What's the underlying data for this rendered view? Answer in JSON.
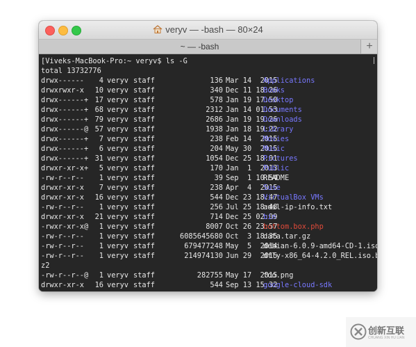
{
  "window": {
    "title": "veryv — -bash — 80×24",
    "tab_label": "~ — -bash",
    "new_tab_symbol": "+",
    "home_icon": "home-icon"
  },
  "terminal": {
    "prompt_line": "[Viveks-MacBook-Pro:~ veryv$ ls -G",
    "total_line": "total 13732776",
    "entries": [
      {
        "perm": "drwx------",
        "links": "4",
        "owner": "veryv",
        "group": "staff",
        "size": "136",
        "date": "Mar 14  2015",
        "name": "Applications",
        "kind": "dir"
      },
      {
        "perm": "drwxrwxr-x",
        "links": "10",
        "owner": "veryv",
        "group": "staff",
        "size": "340",
        "date": "Dec 11 18:26",
        "name": "Books",
        "kind": "dir"
      },
      {
        "perm": "drwx------+",
        "links": "17",
        "owner": "veryv",
        "group": "staff",
        "size": "578",
        "date": "Jan 19 17:50",
        "name": "Desktop",
        "kind": "dir"
      },
      {
        "perm": "drwx------+",
        "links": "68",
        "owner": "veryv",
        "group": "staff",
        "size": "2312",
        "date": "Jan 14 01:53",
        "name": "Documents",
        "kind": "dir"
      },
      {
        "perm": "drwx------+",
        "links": "79",
        "owner": "veryv",
        "group": "staff",
        "size": "2686",
        "date": "Jan 19 19:26",
        "name": "Downloads",
        "kind": "dir"
      },
      {
        "perm": "drwx------@",
        "links": "57",
        "owner": "veryv",
        "group": "staff",
        "size": "1938",
        "date": "Jan 18 19:22",
        "name": "Library",
        "kind": "dir"
      },
      {
        "perm": "drwx------+",
        "links": "7",
        "owner": "veryv",
        "group": "staff",
        "size": "238",
        "date": "Feb 14  2015",
        "name": "Movies",
        "kind": "dir"
      },
      {
        "perm": "drwx------+",
        "links": "6",
        "owner": "veryv",
        "group": "staff",
        "size": "204",
        "date": "May 30  2015",
        "name": "Music",
        "kind": "dir"
      },
      {
        "perm": "drwx------+",
        "links": "31",
        "owner": "veryv",
        "group": "staff",
        "size": "1054",
        "date": "Dec 25 18:01",
        "name": "Pictures",
        "kind": "dir"
      },
      {
        "perm": "drwxr-xr-x+",
        "links": "5",
        "owner": "veryv",
        "group": "staff",
        "size": "170",
        "date": "Jan  1  2013",
        "name": "Public",
        "kind": "dir"
      },
      {
        "perm": "-rw-r--r--",
        "links": "1",
        "owner": "veryv",
        "group": "staff",
        "size": "39",
        "date": "Sep  1 10:54",
        "name": "README",
        "kind": "file"
      },
      {
        "perm": "drwxr-xr-x",
        "links": "7",
        "owner": "veryv",
        "group": "staff",
        "size": "238",
        "date": "Apr  4  2015",
        "name": "Suse",
        "kind": "dir"
      },
      {
        "perm": "drwxr-xr-x",
        "links": "16",
        "owner": "veryv",
        "group": "staff",
        "size": "544",
        "date": "Dec 23 18:47",
        "name": "VirtualBox VMs",
        "kind": "dir"
      },
      {
        "perm": "-rw-r--r--",
        "links": "1",
        "owner": "veryv",
        "group": "staff",
        "size": "256",
        "date": "Jul 25 18:48",
        "name": "adsl-ip-info.txt",
        "kind": "file"
      },
      {
        "perm": "drwxr-xr-x",
        "links": "21",
        "owner": "veryv",
        "group": "staff",
        "size": "714",
        "date": "Dec 25 02:09",
        "name": "bin",
        "kind": "dir"
      },
      {
        "perm": "-rwxr-xr-x@",
        "links": "1",
        "owner": "veryv",
        "group": "staff",
        "size": "8007",
        "date": "Oct 26 23:57",
        "name": "bottom.box.php",
        "kind": "exe"
      },
      {
        "perm": "-rw-r--r--",
        "links": "1",
        "owner": "veryv",
        "group": "staff",
        "size": "6085645680",
        "date": "Oct  3 18:35",
        "name": "data.tar.gz",
        "kind": "file"
      },
      {
        "perm": "-rw-r--r--",
        "links": "1",
        "owner": "veryv",
        "group": "staff",
        "size": "679477248",
        "date": "May  5  2014",
        "name": "debian-6.0.9-amd64-CD-1.iso",
        "kind": "file"
      },
      {
        "perm": "-rw-r--r--",
        "links": "1",
        "owner": "veryv",
        "group": "staff",
        "size": "214974130",
        "date": "Jun 29  2015",
        "name": "dfly-x86_64-4.2.0_REL.iso.b",
        "kind": "file"
      },
      {
        "perm": "",
        "links": "",
        "owner": "",
        "group": "",
        "size": "",
        "date": "",
        "name": "z2",
        "kind": "wrap"
      },
      {
        "perm": "-rw-r--r--@",
        "links": "1",
        "owner": "veryv",
        "group": "staff",
        "size": "282755",
        "date": "May 17  2015",
        "name": "foo.png",
        "kind": "file"
      },
      {
        "perm": "drwxr-xr-x",
        "links": "16",
        "owner": "veryv",
        "group": "staff",
        "size": "544",
        "date": "Sep 13 15:32",
        "name": "google-cloud-sdk",
        "kind": "dir"
      }
    ]
  },
  "watermark": {
    "text": "创新互联",
    "subtext": "CHUANG XIN HU LIAN"
  },
  "colors": {
    "terminal_bg": "#262626",
    "text": "#e8e8e8",
    "directory": "#7878ff",
    "executable": "#e04a3a"
  }
}
